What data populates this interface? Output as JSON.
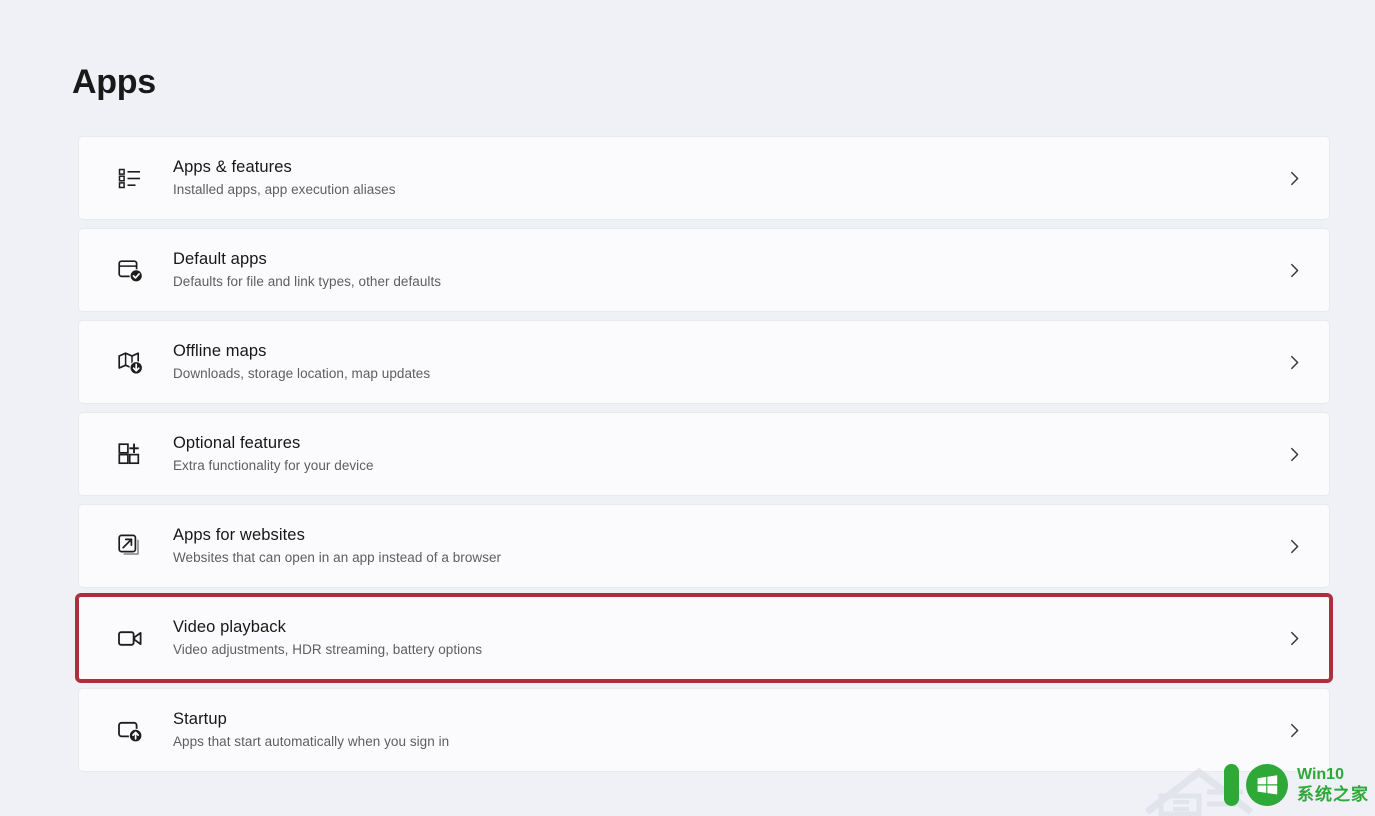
{
  "page": {
    "title": "Apps",
    "background_color": "#eff1f6",
    "card_background_color": "#fbfbfd",
    "highlight_color": "#ab2f3c",
    "accent_green": "#2ea836"
  },
  "settings": {
    "items": [
      {
        "icon": "list-icon",
        "title": "Apps & features",
        "subtitle": "Installed apps, app execution aliases",
        "chevron": "chevron-right-icon",
        "highlighted": false
      },
      {
        "icon": "app-check-icon",
        "title": "Default apps",
        "subtitle": "Defaults for file and link types, other defaults",
        "chevron": "chevron-right-icon",
        "highlighted": false
      },
      {
        "icon": "map-download-icon",
        "title": "Offline maps",
        "subtitle": "Downloads, storage location, map updates",
        "chevron": "chevron-right-icon",
        "highlighted": false
      },
      {
        "icon": "grid-plus-icon",
        "title": "Optional features",
        "subtitle": "Extra functionality for your device",
        "chevron": "chevron-right-icon",
        "highlighted": false
      },
      {
        "icon": "external-link-icon",
        "title": "Apps for websites",
        "subtitle": "Websites that can open in an app instead of a browser",
        "chevron": "chevron-right-icon",
        "highlighted": false
      },
      {
        "icon": "video-camera-icon",
        "title": "Video playback",
        "subtitle": "Video adjustments, HDR streaming, battery options",
        "chevron": "chevron-right-icon",
        "highlighted": true
      },
      {
        "icon": "startup-icon",
        "title": "Startup",
        "subtitle": "Apps that start automatically when you sign in",
        "chevron": "chevron-right-icon",
        "highlighted": false
      }
    ]
  },
  "watermark": {
    "logo_digit_one": "1",
    "logo_digit_zero": "0",
    "line1": "Win10",
    "line2": "系统之家"
  }
}
